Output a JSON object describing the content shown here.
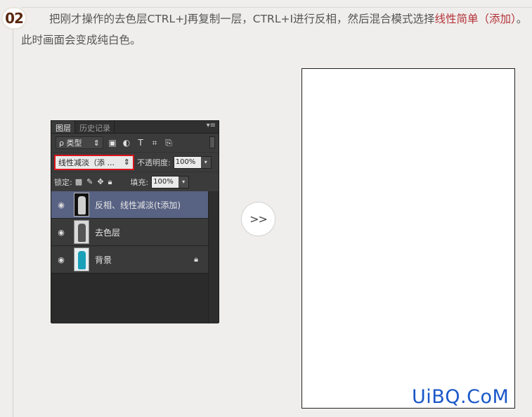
{
  "step": {
    "number": "02",
    "text_before": "把刚才操作的去色层CTRL+J再复制一层，CTRL+I进行反相，然后混合模式选择",
    "highlight": "线性简单（添加）",
    "text_after": "。此时画面会变成纯白色。"
  },
  "panel": {
    "tabs": [
      "图层",
      "历史记录"
    ],
    "menu_icon": "panel-menu-icon",
    "filter_label": "ρ 类型",
    "filter_caret": "⇕",
    "blend_mode": "线性减淡（添 ...",
    "blend_caret": "⇕",
    "opacity_label": "不透明度:",
    "opacity_value": "100%",
    "lock_label": "锁定:",
    "fill_label": "填充:",
    "fill_value": "100%",
    "layers": [
      {
        "name": "反相、线性减淡(t添加)",
        "selected": true,
        "locked": false
      },
      {
        "name": "去色层",
        "selected": false,
        "locked": false
      },
      {
        "name": "背景",
        "selected": false,
        "locked": true
      }
    ]
  },
  "arrow_label": ">>",
  "watermark": "UiBQ.CoM",
  "colors": {
    "highlight": "#b5333a",
    "blend_border": "#d8141b",
    "selected_layer": "#586283",
    "watermark": "#1a57c8"
  }
}
